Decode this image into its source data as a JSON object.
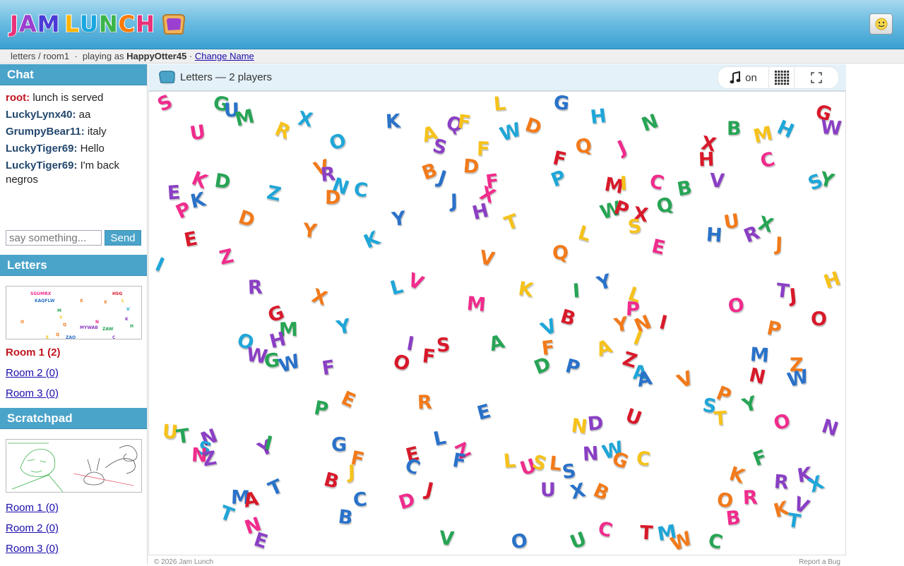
{
  "header": {
    "logo_letters": [
      "J",
      "A",
      "M",
      " ",
      "L",
      "U",
      "N",
      "C",
      "H"
    ],
    "logo_colors": [
      "#e9327a",
      "#9b3fd0",
      "#4b3bd6",
      "#fff",
      "#ffb400",
      "#18a7e0",
      "#3cb44b",
      "#ff7a00",
      "#e9327a"
    ],
    "user_icon": "smiley-icon"
  },
  "breadcrumb": {
    "path": "letters / room1",
    "sep": "·",
    "playing_as_prefix": "playing as",
    "username": "HappyOtter45",
    "change_name": "Change Name"
  },
  "sidebar": {
    "chat_title": "Chat",
    "messages": [
      {
        "who": "root:",
        "text": "lunch is served",
        "root": true
      },
      {
        "who": "LuckyLynx40:",
        "text": "aa"
      },
      {
        "who": "GrumpyBear11:",
        "text": "italy"
      },
      {
        "who": "LuckyTiger69:",
        "text": "Hello"
      },
      {
        "who": "LuckyTiger69:",
        "text": "I'm back negros"
      }
    ],
    "chat_placeholder": "say something...",
    "send_label": "Send",
    "letters_title": "Letters",
    "letters_rooms": [
      "Room 1 (2)",
      "Room 2 (0)",
      "Room 3 (0)"
    ],
    "scratchpad_title": "Scratchpad",
    "scratch_rooms": [
      "Room 1 (0)",
      "Room 2 (0)",
      "Room 3 (0)"
    ]
  },
  "game": {
    "title": "Letters — 2 players",
    "music_label": "on",
    "music_icon": "music-note-icon",
    "grid_icon": "grid-icon",
    "fullscreen_icon": "fullscreen-icon"
  },
  "footer": {
    "copyright": "© 2026 Jam Lunch",
    "report": "Report a Bug"
  },
  "palette": {
    "pink": "#f02c8c",
    "purple": "#8a3fc4",
    "blue": "#2a72c9",
    "cyan": "#1fa6d8",
    "green": "#27a455",
    "yellow": "#f6c21b",
    "orange": "#f27a1a",
    "red": "#d8192a"
  },
  "letters": [
    [
      "S",
      "pink",
      233,
      147
    ],
    [
      "G",
      "green",
      311,
      148
    ],
    [
      "U",
      "blue",
      326,
      157
    ],
    [
      "M",
      "green",
      342,
      168
    ],
    [
      "R",
      "yellow",
      399,
      186
    ],
    [
      "X",
      "cyan",
      431,
      170
    ],
    [
      "K",
      "blue",
      555,
      173
    ],
    [
      "A",
      "yellow",
      607,
      191
    ],
    [
      "Q",
      "purple",
      641,
      177
    ],
    [
      "F",
      "yellow",
      657,
      174
    ],
    [
      "L",
      "yellow",
      708,
      148
    ],
    [
      "W",
      "cyan",
      717,
      188
    ],
    [
      "D",
      "orange",
      753,
      180
    ],
    [
      "G",
      "blue",
      793,
      147
    ],
    [
      "H",
      "cyan",
      845,
      166
    ],
    [
      "N",
      "green",
      918,
      175
    ],
    [
      "G",
      "red",
      1164,
      161
    ],
    [
      "W",
      "purple",
      1171,
      182
    ],
    [
      "U",
      "pink",
      278,
      189
    ],
    [
      "O",
      "cyan",
      476,
      202
    ],
    [
      "S",
      "purple",
      622,
      209
    ],
    [
      "F",
      "yellow",
      684,
      212
    ],
    [
      "Q",
      "orange",
      824,
      208
    ],
    [
      "J",
      "pink",
      885,
      210
    ],
    [
      "F",
      "red",
      792,
      226
    ],
    [
      "B",
      "green",
      1038,
      183
    ],
    [
      "M",
      "yellow",
      1076,
      192
    ],
    [
      "H",
      "cyan",
      1110,
      184
    ],
    [
      "X",
      "red",
      1002,
      205
    ],
    [
      "H",
      "red",
      998,
      227
    ],
    [
      "C",
      "pink",
      1086,
      228
    ],
    [
      "K",
      "pink",
      281,
      256
    ],
    [
      "D",
      "green",
      313,
      258
    ],
    [
      "E",
      "purple",
      246,
      274
    ],
    [
      "V",
      "orange",
      454,
      239
    ],
    [
      "N",
      "cyan",
      480,
      265
    ],
    [
      "C",
      "cyan",
      510,
      270
    ],
    [
      "R",
      "purple",
      463,
      248
    ],
    [
      "B",
      "orange",
      607,
      244
    ],
    [
      "J",
      "blue",
      630,
      253
    ],
    [
      "D",
      "orange",
      665,
      237
    ],
    [
      "F",
      "pink",
      697,
      258
    ],
    [
      "P",
      "cyan",
      790,
      254
    ],
    [
      "C",
      "pink",
      929,
      259
    ],
    [
      "V",
      "purple",
      1014,
      257
    ],
    [
      "B",
      "green",
      968,
      268
    ],
    [
      "S",
      "cyan",
      1154,
      259
    ],
    [
      "Y",
      "green",
      1170,
      256
    ],
    [
      "D",
      "orange",
      469,
      281
    ],
    [
      "K",
      "blue",
      279,
      285
    ],
    [
      "P",
      "pink",
      259,
      299
    ],
    [
      "Z",
      "cyan",
      387,
      275
    ],
    [
      "J",
      "blue",
      647,
      286
    ],
    [
      "H",
      "purple",
      678,
      301
    ],
    [
      "X",
      "pink",
      689,
      277
    ],
    [
      "M",
      "red",
      865,
      264
    ],
    [
      "I",
      "yellow",
      887,
      261
    ],
    [
      "W",
      "green",
      859,
      299
    ],
    [
      "P",
      "red",
      879,
      297
    ],
    [
      "X",
      "red",
      906,
      305
    ],
    [
      "S",
      "yellow",
      898,
      322
    ],
    [
      "Q",
      "green",
      939,
      292
    ],
    [
      "D",
      "orange",
      347,
      311
    ],
    [
      "Y",
      "orange",
      438,
      328
    ],
    [
      "Y",
      "blue",
      564,
      311
    ],
    [
      "T",
      "yellow",
      724,
      316
    ],
    [
      "L",
      "yellow",
      828,
      332
    ],
    [
      "H",
      "blue",
      1009,
      334
    ],
    [
      "U",
      "orange",
      1034,
      315
    ],
    [
      "R",
      "purple",
      1063,
      333
    ],
    [
      "X",
      "green",
      1083,
      319
    ],
    [
      "J",
      "orange",
      1107,
      347
    ],
    [
      "E",
      "red",
      270,
      340
    ],
    [
      "K",
      "cyan",
      525,
      341
    ],
    [
      "E",
      "pink",
      932,
      351
    ],
    [
      "Q",
      "orange",
      791,
      359
    ],
    [
      "Z",
      "pink",
      320,
      365
    ],
    [
      "I",
      "cyan",
      230,
      376
    ],
    [
      "V",
      "orange",
      688,
      367
    ],
    [
      "R",
      "purple",
      360,
      408
    ],
    [
      "L",
      "cyan",
      562,
      408
    ],
    [
      "V",
      "pink",
      587,
      400
    ],
    [
      "K",
      "yellow",
      743,
      411
    ],
    [
      "I",
      "green",
      820,
      413
    ],
    [
      "Y",
      "blue",
      855,
      401
    ],
    [
      "L",
      "yellow",
      899,
      419
    ],
    [
      "T",
      "purple",
      1108,
      413
    ],
    [
      "J",
      "red",
      1127,
      420
    ],
    [
      "H",
      "yellow",
      1176,
      398
    ],
    [
      "X",
      "orange",
      451,
      422
    ],
    [
      "M",
      "pink",
      670,
      432
    ],
    [
      "O",
      "pink",
      1040,
      434
    ],
    [
      "G",
      "red",
      389,
      446
    ],
    [
      "B",
      "red",
      803,
      451
    ],
    [
      "P",
      "pink",
      895,
      439
    ],
    [
      "Y",
      "orange",
      879,
      461
    ],
    [
      "N",
      "orange",
      908,
      460
    ],
    [
      "I",
      "red",
      943,
      458
    ],
    [
      "O",
      "red",
      1157,
      453
    ],
    [
      "Y",
      "cyan",
      486,
      464
    ],
    [
      "V",
      "cyan",
      776,
      465
    ],
    [
      "P",
      "orange",
      1095,
      467
    ],
    [
      "M",
      "green",
      404,
      468
    ],
    [
      "H",
      "purple",
      391,
      483
    ],
    [
      "O",
      "cyan",
      345,
      485
    ],
    [
      "I",
      "purple",
      585,
      488
    ],
    [
      "S",
      "red",
      627,
      490
    ],
    [
      "A",
      "green",
      702,
      487
    ],
    [
      "I",
      "yellow",
      907,
      480
    ],
    [
      "W",
      "purple",
      358,
      505
    ],
    [
      "G",
      "green",
      383,
      512
    ],
    [
      "W",
      "blue",
      404,
      516
    ],
    [
      "O",
      "red",
      566,
      515
    ],
    [
      "F",
      "red",
      607,
      506
    ],
    [
      "F",
      "orange",
      776,
      494
    ],
    [
      "A",
      "yellow",
      854,
      494
    ],
    [
      "Z",
      "red",
      891,
      511
    ],
    [
      "M",
      "blue",
      1071,
      504
    ],
    [
      "F",
      "purple",
      465,
      522
    ],
    [
      "D",
      "green",
      766,
      519
    ],
    [
      "P",
      "blue",
      810,
      521
    ],
    [
      "A",
      "cyan",
      905,
      529
    ],
    [
      "A",
      "blue",
      911,
      538
    ],
    [
      "V",
      "orange",
      969,
      539
    ],
    [
      "N",
      "red",
      1070,
      534
    ],
    [
      "Z",
      "orange",
      1127,
      518
    ],
    [
      "W",
      "blue",
      1124,
      537
    ],
    [
      "E",
      "orange",
      493,
      567
    ],
    [
      "P",
      "green",
      454,
      580
    ],
    [
      "R",
      "orange",
      600,
      571
    ],
    [
      "E",
      "blue",
      685,
      585
    ],
    [
      "P",
      "orange",
      1024,
      560
    ],
    [
      "S",
      "cyan",
      1004,
      576
    ],
    [
      "T",
      "yellow",
      1020,
      594
    ],
    [
      "Y",
      "green",
      1061,
      574
    ],
    [
      "U",
      "red",
      895,
      592
    ],
    [
      "N",
      "yellow",
      818,
      605
    ],
    [
      "D",
      "purple",
      841,
      601
    ],
    [
      "O",
      "pink",
      1105,
      599
    ],
    [
      "N",
      "purple",
      1173,
      607
    ],
    [
      "U",
      "yellow",
      239,
      613
    ],
    [
      "T",
      "green",
      259,
      619
    ],
    [
      "N",
      "purple",
      294,
      621
    ],
    [
      "S",
      "cyan",
      289,
      637
    ],
    [
      "N",
      "pink",
      280,
      646
    ],
    [
      "Z",
      "purple",
      296,
      651
    ],
    [
      "Y",
      "purple",
      375,
      636
    ],
    [
      "I",
      "green",
      384,
      629
    ],
    [
      "G",
      "blue",
      478,
      631
    ],
    [
      "L",
      "blue",
      623,
      622
    ],
    [
      "Z",
      "pink",
      655,
      640
    ],
    [
      "F",
      "orange",
      506,
      651
    ],
    [
      "J",
      "yellow",
      502,
      670
    ],
    [
      "E",
      "red",
      584,
      645
    ],
    [
      "C",
      "blue",
      583,
      662
    ],
    [
      "F",
      "blue",
      650,
      654
    ],
    [
      "N",
      "purple",
      834,
      644
    ],
    [
      "W",
      "cyan",
      862,
      639
    ],
    [
      "G",
      "orange",
      876,
      653
    ],
    [
      "C",
      "yellow",
      910,
      651
    ],
    [
      "L",
      "yellow",
      722,
      654
    ],
    [
      "U",
      "pink",
      746,
      663
    ],
    [
      "S",
      "yellow",
      763,
      657
    ],
    [
      "L",
      "orange",
      787,
      658
    ],
    [
      "S",
      "blue",
      805,
      669
    ],
    [
      "F",
      "green",
      1076,
      650
    ],
    [
      "K",
      "orange",
      1042,
      674
    ],
    [
      "R",
      "purple",
      1105,
      684
    ],
    [
      "K",
      "purple",
      1138,
      674
    ],
    [
      "X",
      "cyan",
      1154,
      687
    ],
    [
      "B",
      "red",
      468,
      682
    ],
    [
      "M",
      "blue",
      336,
      706
    ],
    [
      "A",
      "red",
      354,
      709
    ],
    [
      "T",
      "blue",
      390,
      692
    ],
    [
      "J",
      "red",
      612,
      695
    ],
    [
      "U",
      "purple",
      774,
      695
    ],
    [
      "X",
      "blue",
      817,
      697
    ],
    [
      "B",
      "orange",
      850,
      698
    ],
    [
      "O",
      "orange",
      1024,
      710
    ],
    [
      "R",
      "pink",
      1061,
      706
    ],
    [
      "K",
      "orange",
      1105,
      723
    ],
    [
      "V",
      "purple",
      1133,
      717
    ],
    [
      "T",
      "cyan",
      1124,
      739
    ],
    [
      "C",
      "blue",
      509,
      709
    ],
    [
      "D",
      "pink",
      574,
      711
    ],
    [
      "T",
      "cyan",
      321,
      729
    ],
    [
      "B",
      "blue",
      488,
      734
    ],
    [
      "B",
      "pink",
      1037,
      735
    ],
    [
      "N",
      "pink",
      356,
      746
    ],
    [
      "E",
      "purple",
      369,
      767
    ],
    [
      "V",
      "green",
      631,
      764
    ],
    [
      "O",
      "blue",
      733,
      768
    ],
    [
      "U",
      "green",
      817,
      767
    ],
    [
      "C",
      "pink",
      856,
      751
    ],
    [
      "T",
      "red",
      915,
      756
    ],
    [
      "M",
      "cyan",
      940,
      756
    ],
    [
      "W",
      "orange",
      959,
      768
    ],
    [
      "C",
      "green",
      1012,
      768
    ]
  ]
}
